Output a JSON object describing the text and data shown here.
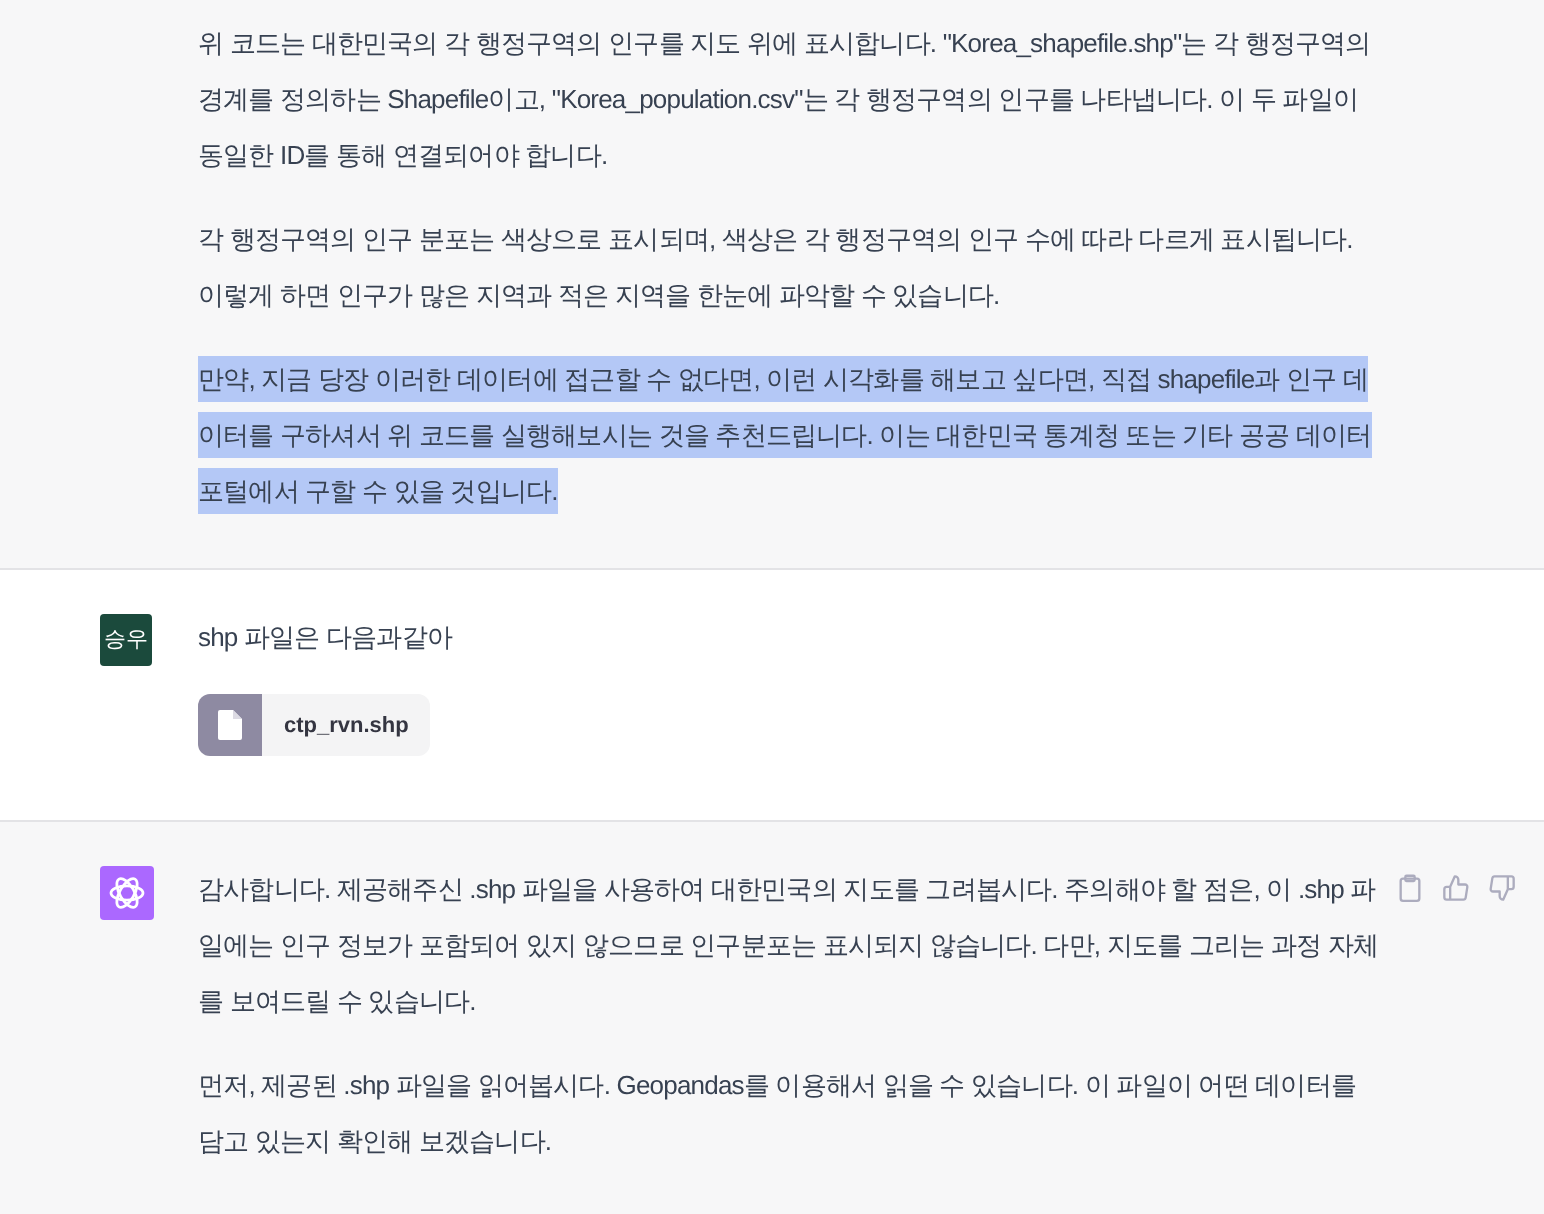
{
  "conversation": [
    {
      "kind": "assistant_fragment",
      "paragraphs": [
        {
          "text": "위 코드는 대한민국의 각 행정구역의 인구를 지도 위에 표시합니다. \"Korea_shapefile.shp\"는 각 행정구역의 경계를 정의하는 Shapefile이고, \"Korea_population.csv\"는 각 행정구역의 인구를 나타냅니다. 이 두 파일이 동일한 ID를 통해 연결되어야 합니다.",
          "highlighted": false
        },
        {
          "text": "각 행정구역의 인구 분포는 색상으로 표시되며, 색상은 각 행정구역의 인구 수에 따라 다르게 표시됩니다. 이렇게 하면 인구가 많은 지역과 적은 지역을 한눈에 파악할 수 있습니다.",
          "highlighted": false
        },
        {
          "text": "만약, 지금 당장 이러한 데이터에 접근할 수 없다면, 이런 시각화를 해보고 싶다면, 직접 shapefile과 인구 데이터를 구하셔서 위 코드를 실행해보시는 것을 추천드립니다. 이는 대한민국 통계청 또는 기타 공공 데이터 포털에서 구할 수 있을 것입니다.",
          "highlighted": true
        }
      ]
    },
    {
      "kind": "user",
      "avatar": "승우",
      "paragraphs": [
        {
          "text": "shp 파일은 다음과같아",
          "highlighted": false
        }
      ],
      "attachments": [
        {
          "name": "ctp_rvn.shp"
        }
      ]
    },
    {
      "kind": "assistant",
      "paragraphs": [
        {
          "text": "감사합니다. 제공해주신 .shp 파일을 사용하여 대한민국의 지도를 그려봅시다. 주의해야 할 점은, 이 .shp 파일에는 인구 정보가 포함되어 있지 않으므로 인구분포는 표시되지 않습니다. 다만, 지도를 그리는 과정 자체를 보여드릴 수 있습니다.",
          "highlighted": false
        },
        {
          "text": "먼저, 제공된 .shp 파일을 읽어봅시다. Geopandas를 이용해서 읽을 수 있습니다. 이 파일이 어떤 데이터를 담고 있는지 확인해 보겠습니다.",
          "highlighted": false
        }
      ]
    }
  ]
}
